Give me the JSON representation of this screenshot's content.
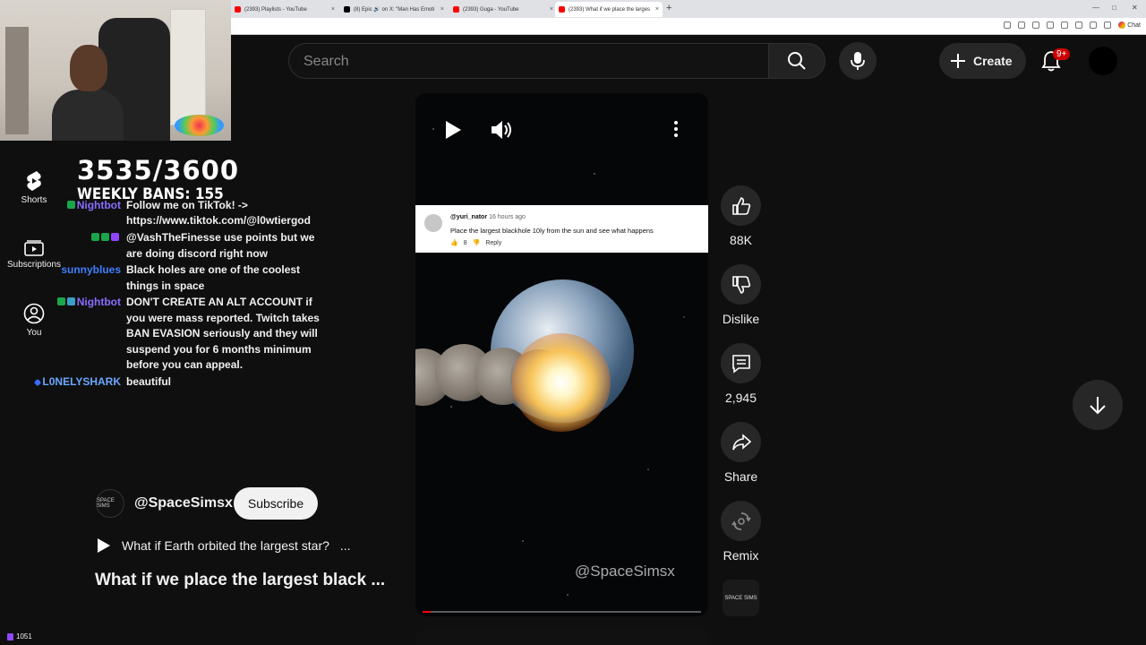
{
  "tabs": [
    {
      "label": "(2393) Playlists - YouTube"
    },
    {
      "label": "(8) Epic 🔊 on X: \"Man Has Emoti"
    },
    {
      "label": "(2393) Guga - YouTube"
    },
    {
      "label": "(2393) What if we place the larges"
    }
  ],
  "tab_close": "×",
  "new_tab": "+",
  "browser": {
    "chat_label": "Chat"
  },
  "overlay": {
    "counter": "3535/3600",
    "weekly_bans": "WEEKLY BANS: 155"
  },
  "sidebar": {
    "items": [
      {
        "label": "Shorts"
      },
      {
        "label": "Subscriptions"
      },
      {
        "label": "You"
      }
    ]
  },
  "chat": {
    "messages": [
      {
        "user": "Nightbot",
        "text": "Follow me on TikTok! ->"
      },
      {
        "user": "",
        "text": "https://www.tiktok.com/@l0wtiergod"
      },
      {
        "user": "",
        "text": "@VashTheFinesse use points but we"
      },
      {
        "user": "",
        "text": "are doing discord right now"
      },
      {
        "user": "sunnyblues",
        "text": "Black holes are one of the coolest"
      },
      {
        "user": "",
        "text": "things in space"
      },
      {
        "user": "Nightbot",
        "text": "DON'T CREATE AN ALT ACCOUNT if"
      },
      {
        "user": "",
        "text": "you were mass reported. Twitch takes"
      },
      {
        "user": "",
        "text": "BAN EVASION seriously and they will"
      },
      {
        "user": "",
        "text": "suspend you for 6 months minimum"
      },
      {
        "user": "",
        "text": "before you can appeal."
      },
      {
        "user": "L0NELYSHARK",
        "text": "beautiful"
      }
    ]
  },
  "header": {
    "search_placeholder": "Search",
    "create_label": "Create",
    "notif_count": "9+"
  },
  "video": {
    "comment": {
      "user": "@yuri_nator",
      "time": "16 hours ago",
      "text": "Place the largest blackhole 10ly from the sun and see what happens",
      "likes": "8",
      "reply": "Reply"
    },
    "watermark": "@SpaceSimsx",
    "progress": 0.03
  },
  "actions": {
    "likes": "88K",
    "dislike": "Dislike",
    "comments": "2,945",
    "share": "Share",
    "remix": "Remix"
  },
  "channel": {
    "name": "@SpaceSimsx",
    "subscribe": "Subscribe",
    "avatar_text": "SPACE SIMS"
  },
  "related": {
    "title": "What if Earth orbited the largest star?",
    "ellipsis": "..."
  },
  "short_title": "What if we place the largest black ...",
  "viewers": "1051",
  "colors": {
    "bg": "#0f0f0f",
    "accent_red": "#cc0000",
    "nightbot": "#8a6cff",
    "sunnyblues": "#3d7fff",
    "loneyshark": "#6aa7ff"
  }
}
